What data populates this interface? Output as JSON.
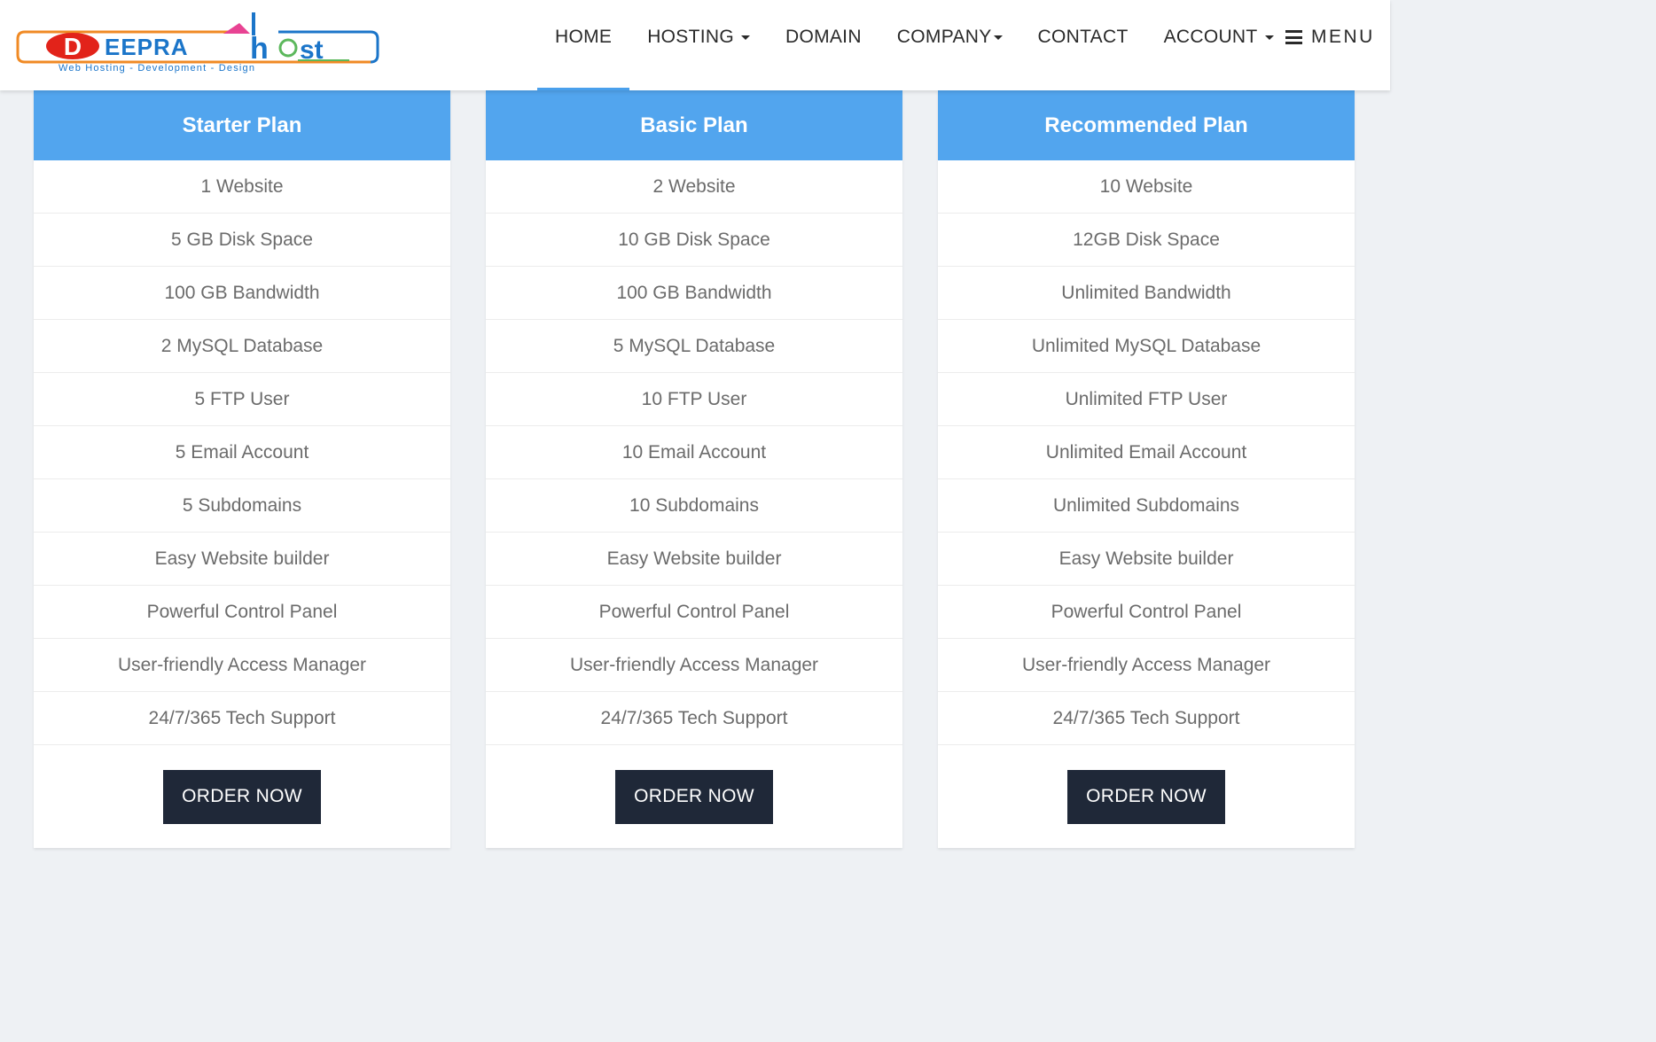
{
  "brand": {
    "logo_letters": [
      "D",
      "EEPRA",
      "h",
      "st"
    ],
    "tagline": "Web Hosting - Development - Design",
    "colors": {
      "blue": "#1b75c9",
      "orange": "#f08a24",
      "red": "#e2231a",
      "green": "#5cb85c",
      "pink": "#e84393"
    }
  },
  "nav": {
    "items": [
      {
        "label": "HOME",
        "dropdown": false,
        "active": true
      },
      {
        "label": "HOSTING",
        "dropdown": true,
        "active": false
      },
      {
        "label": "DOMAIN",
        "dropdown": false,
        "active": false
      },
      {
        "label": "COMPANY",
        "dropdown": true,
        "active": false
      },
      {
        "label": "CONTACT",
        "dropdown": false,
        "active": false
      },
      {
        "label": "ACCOUNT",
        "dropdown": true,
        "active": false
      }
    ],
    "menu_label": "MENU",
    "menu_icon": "hamburger-icon",
    "accent": "#4aa0ec"
  },
  "plans": [
    {
      "name": "Starter Plan",
      "features": [
        "1 Website",
        "5 GB Disk Space",
        "100 GB Bandwidth",
        "2 MySQL Database",
        "5 FTP User",
        "5 Email Account",
        "5 Subdomains",
        "Easy Website builder",
        "Powerful Control Panel",
        "User-friendly Access Manager",
        "24/7/365 Tech Support"
      ],
      "button": "ORDER NOW"
    },
    {
      "name": "Basic Plan",
      "features": [
        "2 Website",
        "10 GB Disk Space",
        "100 GB Bandwidth",
        "5 MySQL Database",
        "10 FTP User",
        "10 Email Account",
        "10 Subdomains",
        "Easy Website builder",
        "Powerful Control Panel",
        "User-friendly Access Manager",
        "24/7/365 Tech Support"
      ],
      "button": "ORDER NOW"
    },
    {
      "name": "Recommended Plan",
      "features": [
        "10 Website",
        "12GB Disk Space",
        "Unlimited Bandwidth",
        "Unlimited MySQL Database",
        "Unlimited FTP User",
        "Unlimited Email Account",
        "Unlimited Subdomains",
        "Easy Website builder",
        "Powerful Control Panel",
        "User-friendly Access Manager",
        "24/7/365 Tech Support"
      ],
      "button": "ORDER NOW"
    }
  ],
  "colors": {
    "plan_header": "#52a5ee",
    "button_bg": "#1f2838",
    "feature_text": "#6b6b6b",
    "page_bg": "#eef1f4"
  }
}
